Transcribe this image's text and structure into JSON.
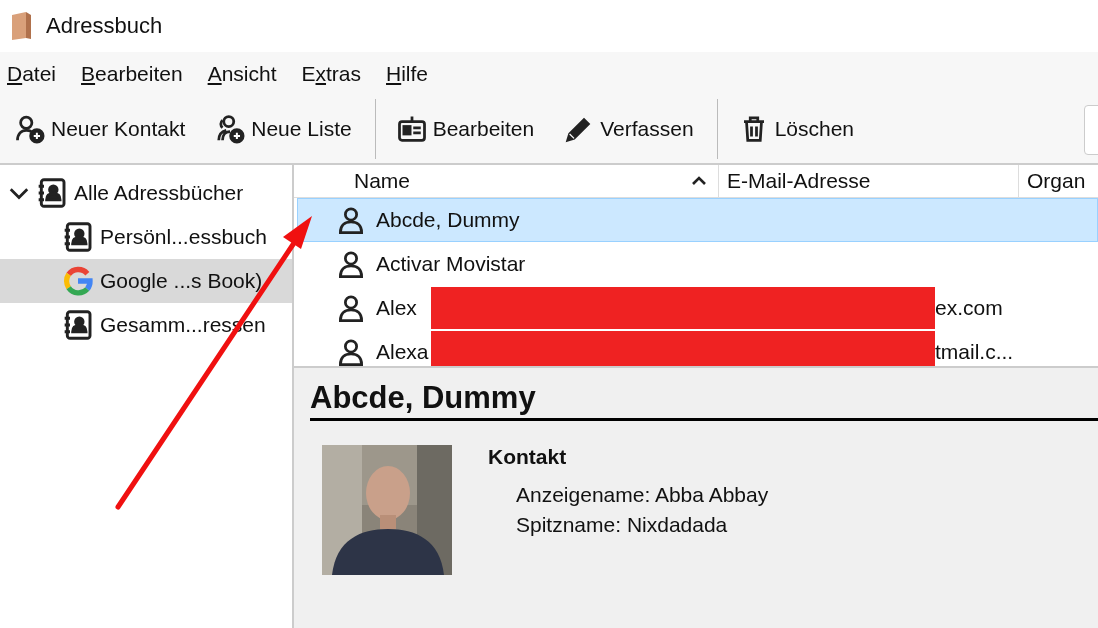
{
  "window": {
    "title": "Adressbuch"
  },
  "menu": [
    {
      "parts": [
        {
          "text": "D",
          "underlined": true
        },
        {
          "text": "atei",
          "underlined": false
        }
      ]
    },
    {
      "parts": [
        {
          "text": "B",
          "underlined": true
        },
        {
          "text": "earbeiten",
          "underlined": false
        }
      ]
    },
    {
      "parts": [
        {
          "text": "A",
          "underlined": true
        },
        {
          "text": "nsicht",
          "underlined": false
        }
      ]
    },
    {
      "parts": [
        {
          "text": "E",
          "underlined": false
        },
        {
          "text": "x",
          "underlined": true
        },
        {
          "text": "tras",
          "underlined": false
        }
      ]
    },
    {
      "parts": [
        {
          "text": "H",
          "underlined": true
        },
        {
          "text": "ilfe",
          "underlined": false
        }
      ]
    }
  ],
  "toolbar": [
    {
      "kind": "new-contact",
      "label": "Neuer Kontakt"
    },
    {
      "kind": "new-list",
      "label": "Neue Liste"
    },
    {
      "kind": "separator"
    },
    {
      "kind": "edit",
      "label": "Bearbeiten"
    },
    {
      "kind": "compose",
      "label": "Verfassen"
    },
    {
      "kind": "separator"
    },
    {
      "kind": "delete",
      "label": "Löschen"
    }
  ],
  "sidebar": {
    "items": [
      {
        "label": "Alle Adressbücher",
        "kind": "addressbook",
        "expanded": true,
        "selected": false,
        "children": [
          {
            "label": "Persönl...essbuch",
            "kind": "addressbook",
            "selected": false
          },
          {
            "label": "Google ...s Book)",
            "kind": "google",
            "selected": true
          },
          {
            "label": "Gesamm...ressen",
            "kind": "addressbook",
            "selected": false
          }
        ]
      }
    ]
  },
  "table": {
    "columns": [
      {
        "label": "Name",
        "sorted": true
      },
      {
        "label": "E-Mail-Adresse",
        "sorted": false
      },
      {
        "label": "Organ",
        "sorted": false
      }
    ],
    "rows": [
      {
        "name": "Abcde, Dummy",
        "selected": true,
        "redacted": false
      },
      {
        "name": "Activar Movistar",
        "selected": false,
        "redacted": false
      },
      {
        "name": "Alex",
        "email": "ex.com",
        "selected": false,
        "redacted": true
      },
      {
        "name": "Alexa",
        "email": "tmail.c...",
        "selected": false,
        "redacted": true
      }
    ]
  },
  "details": {
    "name": "Abcde, Dummy",
    "section": "Kontakt",
    "fields": [
      {
        "label": "Anzeigename:",
        "value": "Abba Abbay"
      },
      {
        "label": "Spitzname:",
        "value": "Nixdadada"
      }
    ]
  },
  "annotations": [
    {
      "kind": "arrow"
    }
  ]
}
